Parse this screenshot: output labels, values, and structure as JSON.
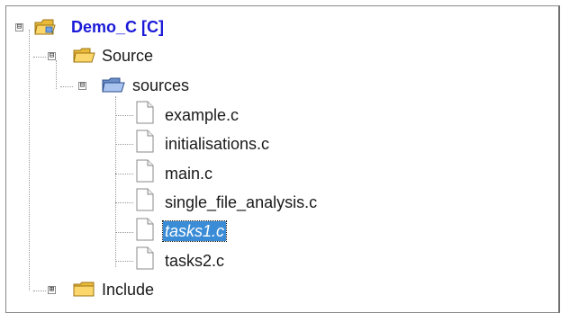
{
  "tree": {
    "project": {
      "label": "Demo_C [C]",
      "expander": "⊟",
      "icon": "project-folder-icon"
    },
    "source": {
      "label": "Source",
      "expander": "⊟",
      "icon": "folder-open-icon"
    },
    "sources": {
      "label": "sources",
      "expander": "⊟",
      "icon": "folder-blue-open-icon"
    },
    "files": [
      {
        "label": "example.c"
      },
      {
        "label": "initialisations.c"
      },
      {
        "label": "main.c"
      },
      {
        "label": "single_file_analysis.c"
      },
      {
        "label": "tasks1.c",
        "selected": true
      },
      {
        "label": "tasks2.c"
      }
    ],
    "include": {
      "label": "Include",
      "expander": "⊞",
      "icon": "folder-icon"
    }
  },
  "colors": {
    "selection": "#3a8cd6",
    "project_text": "#1a1ad8",
    "folder_yellow": "#f2c94c"
  }
}
